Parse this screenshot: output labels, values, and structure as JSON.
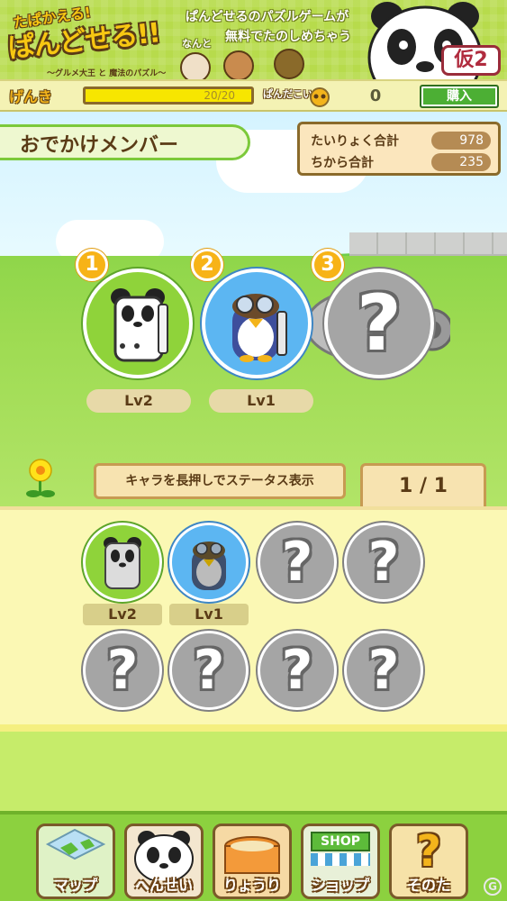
{
  "banner": {
    "logo_top": "たぱかえる!",
    "logo_main": "ぱんどせる!!",
    "logo_sub": "〜グルメ大王 と 魔法のパズル〜",
    "copy_line1": "ぱんどせるのパズルゲームが",
    "copy_nanto": "なんと",
    "copy_line2": "無料でたのしめちゃう",
    "kari_badge": "仮2"
  },
  "status": {
    "genki_label": "げんき",
    "genki_text": "20/20",
    "genki_ratio": 1.0,
    "coin_label": "ぱんだこいん",
    "coin_value": "0",
    "buy_label": "購入"
  },
  "party": {
    "title": "おでかけメンバー",
    "stats": [
      {
        "label": "たいりょく合計",
        "value": "978"
      },
      {
        "label": "ちから合計",
        "value": "235"
      }
    ],
    "slots": [
      {
        "number": "1",
        "level": "Lv2",
        "character": "panda",
        "color": "green"
      },
      {
        "number": "2",
        "level": "Lv1",
        "character": "penguin",
        "color": "blue"
      },
      {
        "number": "3",
        "level": "",
        "character": "unknown",
        "color": "gray"
      }
    ],
    "hint": "キャラを長押しでステータス表示",
    "page": "1 / 1"
  },
  "inventory": {
    "items": [
      {
        "character": "panda",
        "color": "green",
        "level": "Lv2"
      },
      {
        "character": "penguin",
        "color": "blue",
        "level": "Lv1"
      },
      {
        "character": "unknown",
        "color": "gray",
        "level": ""
      },
      {
        "character": "unknown",
        "color": "gray",
        "level": ""
      },
      {
        "character": "unknown",
        "color": "gray",
        "level": ""
      },
      {
        "character": "unknown",
        "color": "gray",
        "level": ""
      },
      {
        "character": "unknown",
        "color": "gray",
        "level": ""
      },
      {
        "character": "unknown",
        "color": "gray",
        "level": ""
      }
    ]
  },
  "nav": [
    {
      "label": "マップ",
      "icon": "map-icon"
    },
    {
      "label": "へんせい",
      "icon": "panda-icon"
    },
    {
      "label": "りょうり",
      "icon": "cooking-pot-icon"
    },
    {
      "label": "ショップ",
      "icon": "shop-icon",
      "sign": "SHOP"
    },
    {
      "label": "そのた",
      "icon": "question-icon"
    }
  ],
  "colors": {
    "accent_green": "#8fd33a",
    "accent_blue": "#5cb6f2",
    "brown": "#5a3b16",
    "yellow": "#f7e600"
  }
}
